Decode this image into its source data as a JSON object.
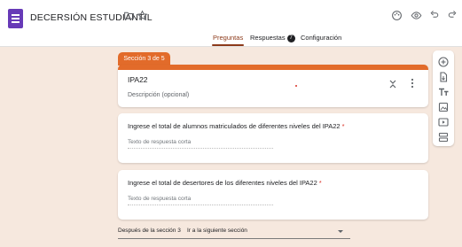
{
  "header": {
    "title": "DECERSIÓN ESTUDIANTIL",
    "icons": [
      "palette-icon",
      "eye-icon",
      "undo-icon",
      "redo-icon",
      "folder-icon",
      "star-icon"
    ]
  },
  "tabs": {
    "preguntas": "Preguntas",
    "respuestas": "Respuestas",
    "respuestas_count": "7",
    "configuracion": "Configuración"
  },
  "section": {
    "tab_label": "Sección 3 de 5",
    "title": "IPA22",
    "description_placeholder": "Descripción (opcional)"
  },
  "questions": [
    {
      "label": "Ingrese el total de alumnos matriculados  de diferentes niveles del  IPA22",
      "required_mark": "*",
      "answer_placeholder": "Texto de respuesta corta"
    },
    {
      "label": "Ingrese el total de desertores de los  diferentes niveles del IPA22",
      "required_mark": "*",
      "answer_placeholder": "Texto de respuesta corta"
    }
  ],
  "after_section": {
    "label": "Después de la sección 3",
    "selected": "Ir a la siguiente sección"
  },
  "toolbar": {
    "icons": [
      "add-question-icon",
      "import-questions-icon",
      "add-title-icon",
      "add-image-icon",
      "add-video-icon",
      "add-section-icon"
    ]
  },
  "colors": {
    "accent": "#e26b2a",
    "tab_active": "#8c3a1a",
    "background": "#f6e8de",
    "logo": "#673ab7",
    "required": "#d93025"
  }
}
